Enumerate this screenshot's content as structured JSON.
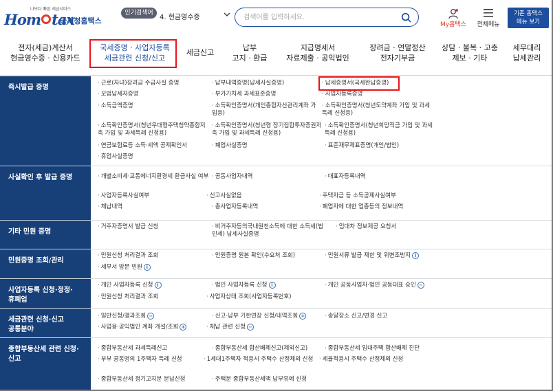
{
  "header": {
    "logo_slogan": "나보다 빠른 세금서비스",
    "logo_text_pre": "Hom",
    "logo_text_post": "tax",
    "logo_kr": "국세청홈택스",
    "popular_label": "인기검색어",
    "popular_value": "4.  현금영수증",
    "search_placeholder": "검색어를 입력하세요.",
    "my_tax_label": "My홈택스",
    "all_menu_label": "전체메뉴",
    "classic_line1": "기존 홈택스",
    "classic_line2": "메뉴 보기",
    "colors": {
      "brand": "#1d4e9f",
      "accent": "#e23b2e",
      "highlight": "#e8141a"
    }
  },
  "gnb": [
    {
      "line1": "전자(세금)계산서",
      "line2": "현금영수증 · 신용카드"
    },
    {
      "line1": "국세증명 · 사업자등록",
      "line2": "세금관련 신청/신고"
    },
    {
      "line1": "세금신고",
      "line2": ""
    },
    {
      "line1": "납부",
      "line2": "고지 · 환급"
    },
    {
      "line1": "지급명세서",
      "line2": "자료제출 · 공익법인"
    },
    {
      "line1": "장려금 · 연말정산",
      "line2": "전자기부금"
    },
    {
      "line1": "상담 · 불복 · 고충",
      "line2": "제보 · 기타"
    },
    {
      "line1": "세무대리",
      "line2": "납세관리"
    }
  ],
  "sections": [
    {
      "title": "즉시발급 증명",
      "items": [
        "근로(자녀)장려금 수급사실 증명",
        "납부내역증명(납세사실증명)",
        "납세증명서(국세완납증명)",
        "모범납세자증명",
        "부가가치세 과세표준증명",
        "사업자등록증명",
        "소득금액증명",
        "소득확인증명서(개인종합자산관리계좌 가입용)",
        "소득확인증명서(청년도약계좌 가입 및 과세특례 신청용)",
        "소득확인증명서(청년우대형주택청약종합저축 가입 및 과세특례 신청용)",
        "소득확인증명서(청년형 장기집합투자증권저축 가입 및 과세특례 신청용)",
        "소득확인증명서(청년희망적금 가입 및 과세특례 신청용)",
        "연금보험료등 소득·세액 공제확인서",
        "폐업사실증명",
        "표준재무제표증명(개인/법인)",
        "휴업사실증명"
      ]
    },
    {
      "title": "사실확인 후 발급 증명",
      "items": [
        "개별소비세·교통에너지환경세 환급사실 여부",
        "공동사업자내역",
        "대표자등록내역",
        "사업자등록사실여부",
        "신고사실없음",
        "주택자금 등 소득공제사실여부",
        "체납내역",
        "총사업자등록내역",
        "폐업자에 대한 업종등의 정보내역"
      ]
    },
    {
      "title": "기타 민원 증명",
      "items": [
        "거주자증명서 발급 신청",
        "비거주자등의국내원천소득에 대한 소득세(법인세) 납세사실증명",
        "임대차 정보제공 요청서"
      ]
    },
    {
      "title": "민원증명 조회/관리",
      "items": [
        "민원신청 처리결과 조회",
        "민원증명 원본 확인(수요처 조회)",
        "민원서류 발급 제한 및 위변조방지",
        "세무서 방문 민원"
      ]
    },
    {
      "title_line1": "사업자등록 신청·정정·",
      "title_line2": "휴폐업",
      "items": [
        "개인 사업자등록 신청",
        "법인 사업자등록 신청",
        "개인 공동사업자·법인 공동대표 승인",
        "민원신청 처리결과 조회",
        "사업자상태 조회(사업자등록번호)"
      ]
    },
    {
      "title_line1": "세금관련 신청·신고",
      "title_line2": "공통분야",
      "items": [
        "일반신청/결과조회",
        "신고·납부 기한연장 신청/내역조회",
        "송달장소 신고/변경 신고",
        "사업용·공익법인 계좌 개설/조회",
        "체납 관련 신청"
      ]
    },
    {
      "title_line1": "종합부동산세 관련 신청·",
      "title_line2": "신고",
      "items": [
        "종합부동산세 과세특례신고",
        "종합부동산세 합산배제신고(제외신고)",
        "종합부동산세 임대주택 합산배제 진단",
        "부부 공동명의 1주택자 특례 신청",
        "1세대1주택자 적용시 주택수 산정제외 신청",
        "세율적용시 주택수 산정제외 신청",
        "종합부동산세 정기고지분 분납신청",
        "주택분 종합부동산세액 납부유예 신청"
      ]
    }
  ]
}
